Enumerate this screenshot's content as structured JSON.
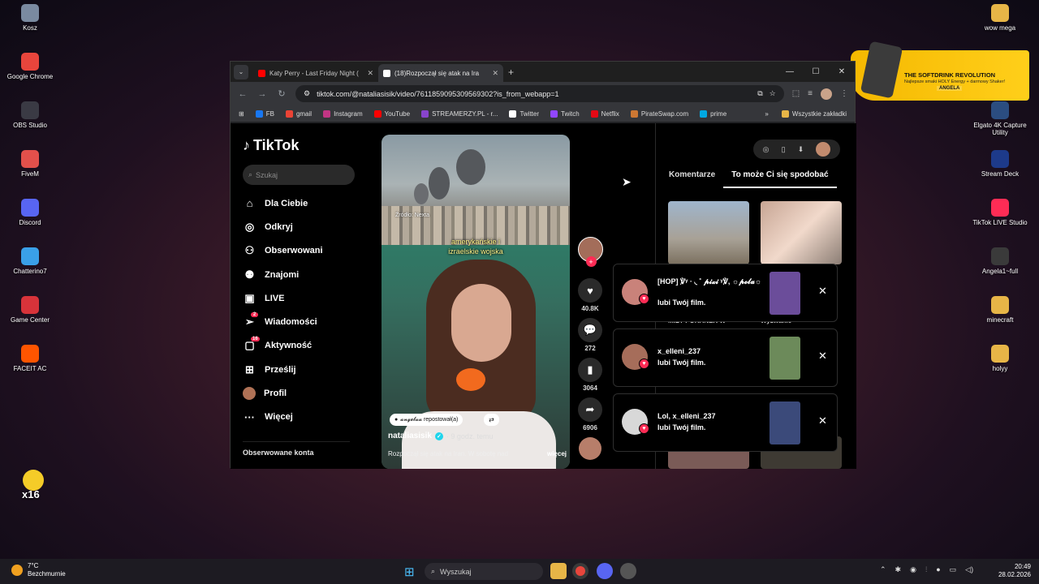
{
  "desktop_left": [
    {
      "label": "Kosz",
      "icon": "trash-icon",
      "color": "#7a8aa0"
    },
    {
      "label": "Google Chrome",
      "icon": "chrome-icon",
      "color": "#e8453c"
    },
    {
      "label": "OBS Studio",
      "icon": "obs-icon",
      "color": "#3a3a44"
    },
    {
      "label": "FiveM",
      "icon": "fivem-icon",
      "color": "#e2504b"
    },
    {
      "label": "Discord",
      "icon": "discord-icon",
      "color": "#5865f2"
    },
    {
      "label": "Chatterino7",
      "icon": "chatterino-icon",
      "color": "#3aa0e8"
    },
    {
      "label": "Game Center",
      "icon": "game-center-icon",
      "color": "#d8333a"
    },
    {
      "label": "FACEIT AC",
      "icon": "faceit-icon",
      "color": "#ff5500"
    }
  ],
  "desktop_right": [
    {
      "label": "wow mega",
      "icon": "folder-icon",
      "color": "#e7b547"
    },
    {
      "label": "Elgato 4K Capture Utility",
      "icon": "elgato-icon",
      "color": "#2b4d80"
    },
    {
      "label": "Stream Deck",
      "icon": "stream-deck-icon",
      "color": "#1d3a8a"
    },
    {
      "label": "TikTok LIVE Studio",
      "icon": "tiktok-live-icon",
      "color": "#fe2c55"
    },
    {
      "label": "Angela1~full",
      "icon": "file-icon",
      "color": "#3a3a3a"
    },
    {
      "label": "minecraft",
      "icon": "folder-icon",
      "color": "#e7b547"
    },
    {
      "label": "holyy",
      "icon": "folder-icon",
      "color": "#e7b547"
    }
  ],
  "promo": {
    "title": "THE SOFTDRINK REVOLUTION",
    "subtitle": "Najlepsze smaki HOLY Energy + darmowy Shaker!",
    "name": "ANGELA"
  },
  "duck_label": "x16",
  "browser": {
    "tabs": [
      {
        "title": "Katy Perry - Last Friday Night (",
        "favicon_color": "#ff0000",
        "active": false
      },
      {
        "title": "(18)Rozpoczął się atak na Ira",
        "favicon_color": "#ffffff",
        "active": true
      }
    ],
    "url": "tiktok.com/@nataliasisik/video/7611859095309569302?is_from_webapp=1",
    "bookmarks": [
      {
        "label": "FB",
        "color": "#1877f2"
      },
      {
        "label": "gmail",
        "color": "#ea4335"
      },
      {
        "label": "Instagram",
        "color": "#c13584"
      },
      {
        "label": "YouTube",
        "color": "#ff0000"
      },
      {
        "label": "STREAMERZY.PL - r...",
        "color": "#8844cc"
      },
      {
        "label": "Twitter",
        "color": "#ffffff"
      },
      {
        "label": "Twitch",
        "color": "#9146ff"
      },
      {
        "label": "Netflix",
        "color": "#e50914"
      },
      {
        "label": "PirateSwap.com",
        "color": "#cc7733"
      },
      {
        "label": "prime",
        "color": "#00a8e1"
      }
    ],
    "all_bookmarks": "Wszystkie zakładki"
  },
  "tiktok": {
    "logo": "TikTok",
    "search_placeholder": "Szukaj",
    "menu": [
      {
        "label": "Dla Ciebie",
        "icon": "home-icon",
        "glyph": "⌂"
      },
      {
        "label": "Odkryj",
        "icon": "compass-icon",
        "glyph": "◎"
      },
      {
        "label": "Obserwowani",
        "icon": "following-icon",
        "glyph": "⚇"
      },
      {
        "label": "Znajomi",
        "icon": "friends-icon",
        "glyph": "⚉"
      },
      {
        "label": "LIVE",
        "icon": "live-icon",
        "glyph": "▣"
      },
      {
        "label": "Wiadomości",
        "icon": "messages-icon",
        "glyph": "➢",
        "badge": "2"
      },
      {
        "label": "Aktywność",
        "icon": "activity-icon",
        "glyph": "▢",
        "badge": "16"
      },
      {
        "label": "Prześlij",
        "icon": "upload-icon",
        "glyph": "⊞"
      },
      {
        "label": "Profil",
        "icon": "profile-avatar",
        "glyph": ""
      },
      {
        "label": "Więcej",
        "icon": "more-icon",
        "glyph": "···"
      }
    ],
    "following_header": "Obserwowane konta",
    "video": {
      "source": "Źródło: Nexta",
      "caption_line1": "amerykańskie i",
      "caption_line2": "izraelskie wojska",
      "repost": "𝓪𝓷𝓰𝓮𝓵𝓪𝓪 repostował(a)",
      "author": "nataliasisik",
      "time": "· 9 godz. temu",
      "description": "Rozpoczął się atak na Iran. W sobotę nad",
      "more": "więcej"
    },
    "actions": {
      "likes": "40.8K",
      "comments": "272",
      "saves": "3064",
      "shares": "6906"
    },
    "right_tabs": [
      "Komentarze",
      "To może Ci się spodobać"
    ],
    "right_labels": [
      "MIŁY PORANEK W",
      "Wyzwanie"
    ]
  },
  "notifications": [
    {
      "user": "[HOP] ℣ᵞ · ◟ ˚ 𝓹𝓲𝔁𝓲 ᵞ℣, ☼𝓹𝓸𝓵𝓪☼",
      "text": "lubi Twój film.",
      "avatar_color": "#c9827a",
      "thumb_color": "#6b4d9a"
    },
    {
      "user": "x_elleni_237",
      "text": "lubi Twój film.",
      "avatar_color": "#a66d5a",
      "thumb_color": "#6c8a5a"
    },
    {
      "user": "Lol, x_elleni_237",
      "text": "lubi Twój film.",
      "avatar_color": "#d8d8d8",
      "thumb_color": "#3b4a7a"
    }
  ],
  "taskbar": {
    "temp": "7°C",
    "weather": "Bezchmurnie",
    "search": "Wyszukaj",
    "time": "20:49",
    "date": "28.02.2026"
  }
}
